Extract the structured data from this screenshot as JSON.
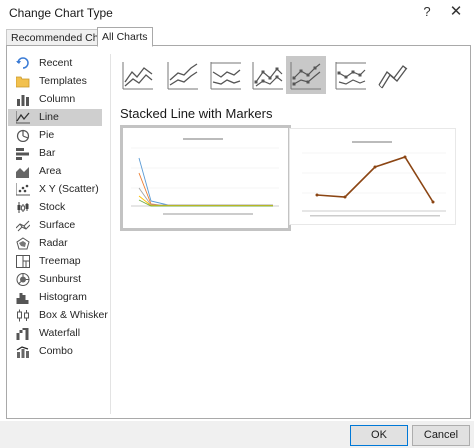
{
  "window": {
    "title": "Change Chart Type",
    "help_label": "?",
    "close_label": "✕"
  },
  "tabs": [
    {
      "label": "Recommended Charts",
      "active": false
    },
    {
      "label": "All Charts",
      "active": true
    }
  ],
  "sidebar": {
    "items": [
      {
        "label": "Recent",
        "icon": "recent-icon",
        "selected": false
      },
      {
        "label": "Templates",
        "icon": "folder-icon",
        "selected": false
      },
      {
        "label": "Column",
        "icon": "column-chart-icon",
        "selected": false
      },
      {
        "label": "Line",
        "icon": "line-chart-icon",
        "selected": true
      },
      {
        "label": "Pie",
        "icon": "pie-chart-icon",
        "selected": false
      },
      {
        "label": "Bar",
        "icon": "bar-chart-icon",
        "selected": false
      },
      {
        "label": "Area",
        "icon": "area-chart-icon",
        "selected": false
      },
      {
        "label": "X Y (Scatter)",
        "icon": "scatter-chart-icon",
        "selected": false
      },
      {
        "label": "Stock",
        "icon": "stock-chart-icon",
        "selected": false
      },
      {
        "label": "Surface",
        "icon": "surface-chart-icon",
        "selected": false
      },
      {
        "label": "Radar",
        "icon": "radar-chart-icon",
        "selected": false
      },
      {
        "label": "Treemap",
        "icon": "treemap-chart-icon",
        "selected": false
      },
      {
        "label": "Sunburst",
        "icon": "sunburst-chart-icon",
        "selected": false
      },
      {
        "label": "Histogram",
        "icon": "histogram-chart-icon",
        "selected": false
      },
      {
        "label": "Box & Whisker",
        "icon": "box-whisker-chart-icon",
        "selected": false
      },
      {
        "label": "Waterfall",
        "icon": "waterfall-chart-icon",
        "selected": false
      },
      {
        "label": "Combo",
        "icon": "combo-chart-icon",
        "selected": false
      }
    ]
  },
  "subtypes": [
    {
      "icon": "line-icon",
      "selected": false
    },
    {
      "icon": "stacked-line-icon",
      "selected": false
    },
    {
      "icon": "100-stacked-line-icon",
      "selected": false
    },
    {
      "icon": "line-with-markers-icon",
      "selected": false
    },
    {
      "icon": "stacked-line-with-markers-icon",
      "selected": true
    },
    {
      "icon": "100-stacked-line-with-markers-icon",
      "selected": false
    },
    {
      "icon": "3d-line-icon",
      "selected": false
    }
  ],
  "selected_subtype_title": "Stacked Line with Markers",
  "colors": {
    "selection": "#c8c8c8",
    "accent": "#0078d7",
    "line_brown": "#8b4513",
    "line_blue": "#5b9bd5",
    "line_orange": "#ed7d31",
    "line_gray": "#a5a5a5",
    "line_yellow": "#ffc000",
    "line_green": "#70ad47"
  },
  "buttons": {
    "ok_label": "OK",
    "cancel_label": "Cancel"
  }
}
